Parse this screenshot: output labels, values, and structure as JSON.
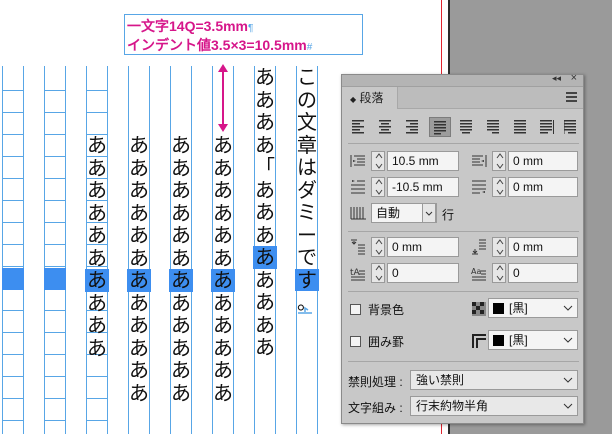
{
  "document": {
    "annotation": {
      "line1": "一文字14Q=3.5mm",
      "line1_mark": "¶",
      "line2": "インデント値3.5×3=10.5mm",
      "line2_mark": "#"
    },
    "columns": [
      {
        "text": "ああああああああああ",
        "highlight_index": 6
      },
      {
        "text": "ああああああああああああ",
        "highlight_index": 6
      },
      {
        "text": "ああああああああああああ",
        "highlight_index": 6
      },
      {
        "text": "ああああああああああああ",
        "highlight_index": 6
      },
      {
        "text": "ああああ「ああああああああ",
        "highlight_index": 8
      },
      {
        "text": "ああああああああああああああ",
        "highlight_index": 8
      },
      {
        "text": "この文章はダミーです。",
        "highlight_index": 9
      }
    ]
  },
  "panel": {
    "tab_label": "段落",
    "tab_icon": "collapse-arrows-icon",
    "left_indent": "10.5 mm",
    "right_indent": "0 mm",
    "first_line_indent": "-10.5 mm",
    "last_line_right_indent": "0 mm",
    "auto_indent_value": "自動",
    "auto_indent_unit": "行",
    "space_before": "0 mm",
    "space_after": "0 mm",
    "drop_cap_lines": "0",
    "drop_cap_chars": "0",
    "shading_label": "背景色",
    "shading_color": "[黒]",
    "border_label": "囲み罫",
    "border_color": "[黒]",
    "kinsoku_label": "禁則処理 :",
    "kinsoku_value": "強い禁則",
    "mojikumi_label": "文字組み :",
    "mojikumi_value": "行末約物半角"
  },
  "colors": {
    "annotation": "#d6168a",
    "frame": "#58a6e6",
    "selection": "#3d8ef0",
    "panel_bg": "#c8c8c8",
    "bleed": "#e0242f"
  }
}
